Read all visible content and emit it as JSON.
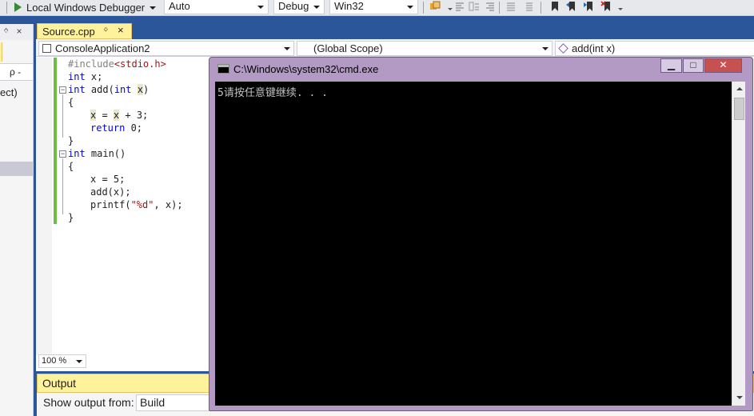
{
  "toolbar": {
    "debugger_label": "Local Windows Debugger",
    "config_auto": "Auto",
    "config_mode": "Debug",
    "config_platform": "Win32"
  },
  "left_panel": {
    "header": "ᛜ ×",
    "search": "ρ -",
    "partial_text": "ect)"
  },
  "editor": {
    "tab_label": "Source.cpp",
    "tab_pin": "ᛜ",
    "tab_close": "×",
    "project": "ConsoleApplication2",
    "scope": "(Global Scope)",
    "member": "add(int x)",
    "zoom": "100 %"
  },
  "code": {
    "l1_directive": "#include",
    "l1_header": "<stdio.h>",
    "l2_type": "int",
    "l2_rest": " x;",
    "l3_type": "int",
    "l3_name": " add(",
    "l3_type2": "int",
    "l3_param": "x",
    "l3_close": ")",
    "l4": "{",
    "l5_var1": "x",
    "l5_mid": " = ",
    "l5_var2": "x",
    "l5_rest": " + 3;",
    "l6_kw": "return",
    "l6_rest": " 0;",
    "l7": "}",
    "l8_type": "int",
    "l8_rest": " main()",
    "l9": "{",
    "l10": "x = 5;",
    "l11": "add(x);",
    "l12_fn": "printf(",
    "l12_str": "\"%d\"",
    "l12_rest": ", x);",
    "l13": "}"
  },
  "output": {
    "title": "Output",
    "show_from_label": "Show output from:",
    "source": "Build"
  },
  "console": {
    "title": "C:\\Windows\\system32\\cmd.exe",
    "minimize": "▁",
    "maximize": "□",
    "close": "✕",
    "text": "5请按任意键继续. . ."
  },
  "colors": {
    "vs_background": "#2b579a",
    "editor_background": "#ffffff",
    "console_frame": "#b39ac4",
    "console_background": "#000000",
    "tab_active": "#fff29d",
    "keyword": "#0000ff",
    "string": "#a31515",
    "change_bar": "#6abf40"
  }
}
